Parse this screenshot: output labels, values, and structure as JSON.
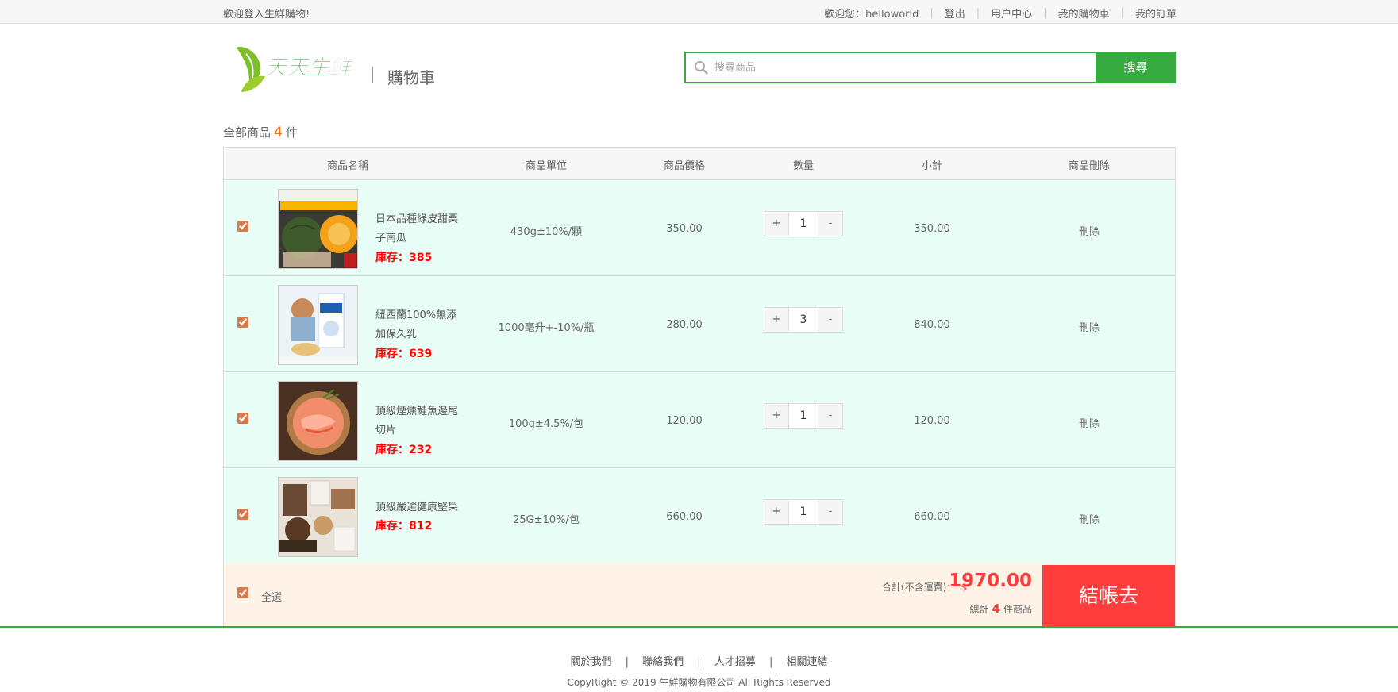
{
  "topbar": {
    "welcome": "歡迎登入生鮮購物!",
    "user_greeting": "歡迎您：helloworld",
    "logout": "登出",
    "user_center": "用户中心",
    "my_cart": "我的購物車",
    "my_orders": "我的訂單"
  },
  "header": {
    "logo_text": "天天生鲜",
    "title": "購物車",
    "search_placeholder": "搜尋商品",
    "search_button": "搜尋"
  },
  "cart": {
    "count_prefix": "全部商品",
    "count": "4",
    "count_suffix": "件",
    "columns": [
      "商品名稱",
      "商品單位",
      "商品價格",
      "數量",
      "小計",
      "商品刪除"
    ],
    "stock_label": "庫存：",
    "delete_label": "刪除",
    "items": [
      {
        "name": "日本品種綠皮甜栗子南瓜",
        "unit": "430g±10%/顆",
        "price": "350.00",
        "qty": "1",
        "subtotal": "350.00",
        "stock": "385",
        "checked": true
      },
      {
        "name": "紐西蘭100%無添加保久乳",
        "unit": "1000毫升+-10%/瓶",
        "price": "280.00",
        "qty": "3",
        "subtotal": "840.00",
        "stock": "639",
        "checked": true
      },
      {
        "name": "頂級煙燻鮭魚邊尾切片",
        "unit": "100g±4.5%/包",
        "price": "120.00",
        "qty": "1",
        "subtotal": "120.00",
        "stock": "232",
        "checked": true
      },
      {
        "name": "頂級嚴選健康堅果",
        "unit": "25G±10%/包",
        "price": "660.00",
        "qty": "1",
        "subtotal": "660.00",
        "stock": "812",
        "checked": true
      }
    ],
    "qty_plus": "+",
    "qty_minus": "-"
  },
  "summary": {
    "select_all": "全選",
    "total_label": "合計(不含運費)：",
    "currency": "$",
    "total_amount": "1970.00",
    "count_prefix": "總計",
    "count": "4",
    "count_suffix": "件商品",
    "checkout": "結帳去"
  },
  "footer": {
    "links": [
      "關於我們",
      "聯絡我們",
      "人才招募",
      "相關連結"
    ],
    "copyright": "CopyRight © 2019 生鮮購物有限公司 All Rights Reserved"
  },
  "colors": {
    "brand_green": "#37ab40",
    "row_bg": "#e8fdf6",
    "summary_bg": "#fff3e8",
    "accent_red": "#ff3d3d",
    "stock_red": "#ff0000"
  }
}
